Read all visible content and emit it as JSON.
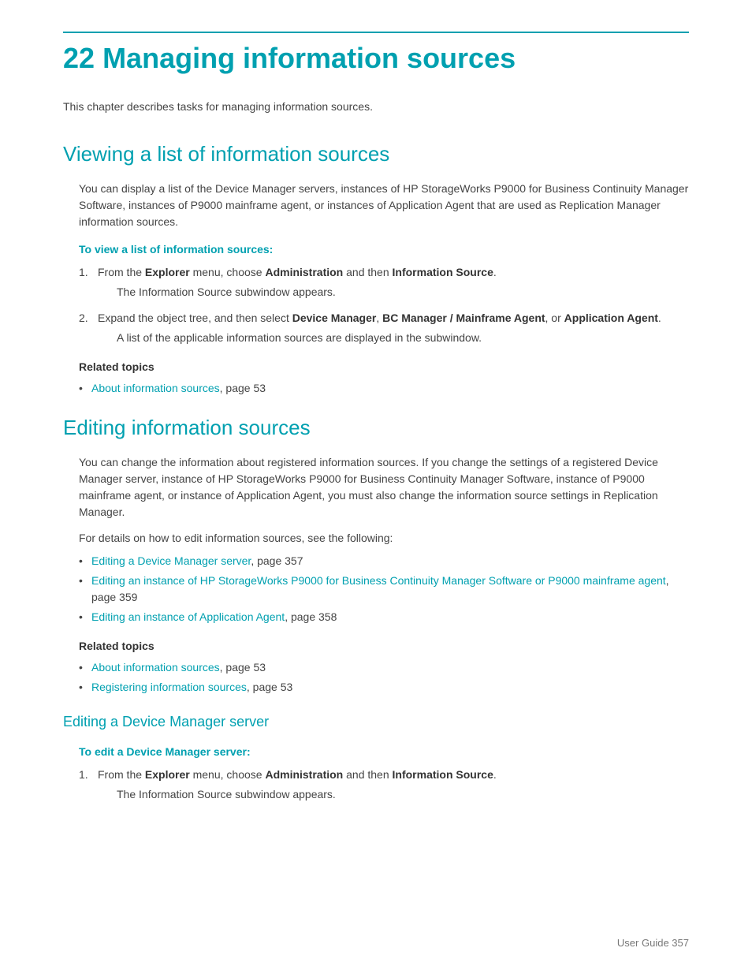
{
  "page": {
    "chapter_number": "22",
    "chapter_title": "Managing information sources",
    "intro_text": "This chapter describes tasks for managing information sources.",
    "footer_text": "User Guide",
    "footer_page": "357"
  },
  "section1": {
    "title": "Viewing a list of information sources",
    "body": "You can display a list of the Device Manager servers, instances of HP StorageWorks P9000 for Business Continuity Manager Software, instances of P9000 mainframe agent, or instances of Application Agent that are used as Replication Manager information sources.",
    "procedure_label": "To view a list of information sources:",
    "steps": [
      {
        "text_parts": [
          "From the ",
          "Explorer",
          " menu, choose ",
          "Administration",
          " and then ",
          "Information Source",
          "."
        ],
        "note": "The Information Source subwindow appears."
      },
      {
        "text_parts": [
          "Expand the object tree, and then select ",
          "Device Manager",
          ", ",
          "BC Manager / Mainframe Agent",
          ", or ",
          "Application Agent",
          "."
        ],
        "note": "A list of the applicable information sources are displayed in the subwindow."
      }
    ],
    "related_topics_label": "Related topics",
    "related_links": [
      {
        "text": "About information sources",
        "page": "page 53"
      }
    ]
  },
  "section2": {
    "title": "Editing information sources",
    "body": "You can change the information about registered information sources. If you change the settings of a registered Device Manager server, instance of HP StorageWorks P9000 for Business Continuity Manager Software, instance of P9000 mainframe agent, or instance of Application Agent, you must also change the information source settings in Replication Manager.",
    "details_intro": "For details on how to edit information sources, see the following:",
    "detail_links": [
      {
        "text": "Editing a Device Manager server",
        "page": "page 357"
      },
      {
        "text": "Editing an instance of HP StorageWorks P9000 for Business Continuity Manager Software or P9000 mainframe agent",
        "page": "page 359"
      },
      {
        "text": "Editing an instance of Application Agent",
        "page": "page 358"
      }
    ],
    "related_topics_label": "Related topics",
    "related_links": [
      {
        "text": "About information sources",
        "page": "page 53"
      },
      {
        "text": "Registering information sources",
        "page": "page 53"
      }
    ]
  },
  "section3": {
    "title": "Editing a Device Manager server",
    "procedure_label": "To edit a Device Manager server:",
    "steps": [
      {
        "text_parts": [
          "From the ",
          "Explorer",
          " menu, choose ",
          "Administration",
          " and then ",
          "Information Source",
          "."
        ],
        "note": "The Information Source subwindow appears."
      }
    ]
  }
}
